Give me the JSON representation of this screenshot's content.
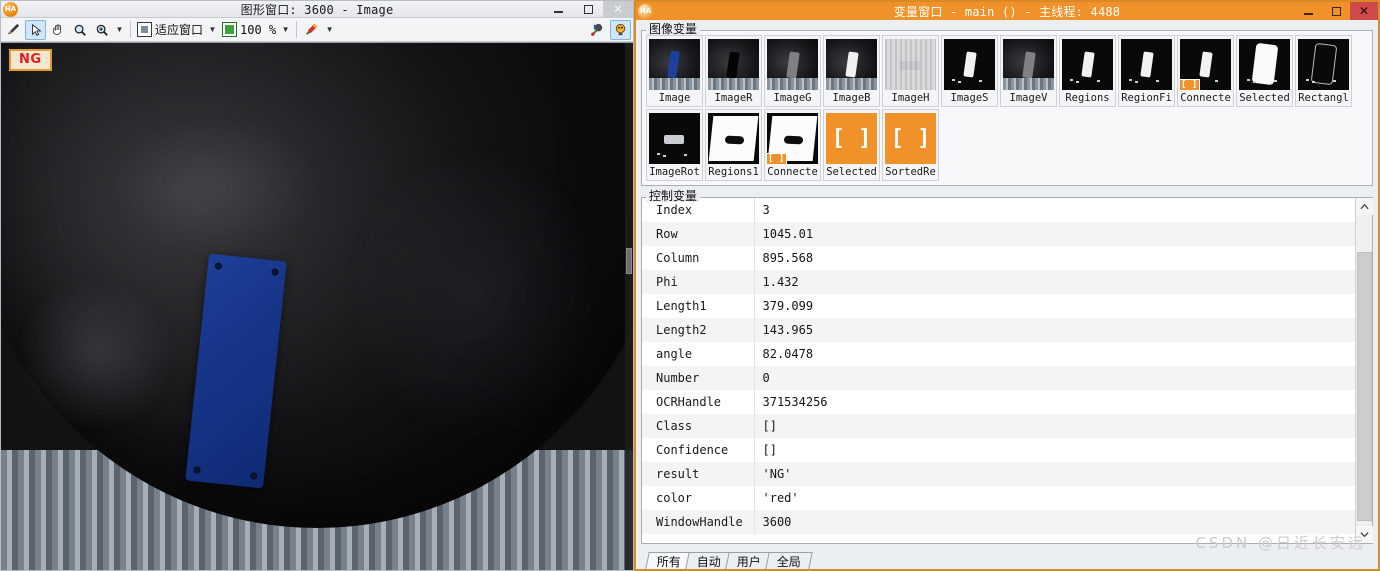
{
  "gfx_window": {
    "app_icon": "halcon-icon",
    "title": "图形窗口: 3600 - Image",
    "window_buttons": {
      "minimize": "–",
      "maximize": "□",
      "close": "✕"
    },
    "toolbar": {
      "tools": [
        {
          "name": "draw-tool-icon",
          "glyph": "✍"
        },
        {
          "name": "arrow-select-icon",
          "glyph": "⬉"
        },
        {
          "name": "pan-hand-icon",
          "glyph": "✋"
        },
        {
          "name": "magnifier-icon",
          "glyph": "🔍"
        },
        {
          "name": "zoom-in-icon",
          "glyph": "🔎"
        }
      ],
      "fit_window_label": "适应窗口",
      "zoom_label": "100 %",
      "color_tool_glyph": "🖌",
      "dropdown_glyph": "▼",
      "right_tools": [
        {
          "name": "measure-tool-icon",
          "glyph": "📐"
        },
        {
          "name": "inspect-tool-icon",
          "glyph": "🔦"
        }
      ]
    },
    "overlay": {
      "ng_badge": "NG"
    }
  },
  "var_window": {
    "app_icon": "halcon-icon",
    "title": "变量窗口 - main () - 主线程: 4488",
    "window_buttons": {
      "minimize": "–",
      "maximize": "□",
      "close": "✕"
    },
    "image_vars": {
      "legend": "图像变量",
      "items": [
        {
          "label": "Image",
          "style": "tv-dark",
          "chip": "blue"
        },
        {
          "label": "ImageR",
          "style": "tv-dark",
          "chip": "black"
        },
        {
          "label": "ImageG",
          "style": "tv-dark",
          "chip": "gray"
        },
        {
          "label": "ImageB",
          "style": "tv-dark",
          "chip": "white"
        },
        {
          "label": "ImageH",
          "style": "tv-bright",
          "chip": "grayband"
        },
        {
          "label": "ImageS",
          "style": "tv-black",
          "chip": "white"
        },
        {
          "label": "ImageV",
          "style": "tv-dark",
          "chip": "gray"
        },
        {
          "label": "Regions",
          "style": "tv-black",
          "chip": "white"
        },
        {
          "label": "RegionFi",
          "style": "tv-black",
          "chip": "white"
        },
        {
          "label": "Connecte",
          "style": "tv-black",
          "chip": "white",
          "badge": "[ ]"
        },
        {
          "label": "Selected",
          "style": "tv-black",
          "chip": "whitebig"
        },
        {
          "label": "Rectangl",
          "style": "tv-black",
          "chip": "outline"
        },
        {
          "label": "ImageRot",
          "style": "tv-black",
          "chip": "grayband"
        },
        {
          "label": "Regions1",
          "style": "tv-white-shape",
          "chip": "none"
        },
        {
          "label": "Connecte",
          "style": "tv-white-shape",
          "chip": "none",
          "badge": "[ ]"
        },
        {
          "label": "Selected",
          "style": "tv-orange",
          "chip": "tuple",
          "tuple_glyph": "[ ]"
        },
        {
          "label": "SortedRe",
          "style": "tv-orange",
          "chip": "tuple",
          "tuple_glyph": "[ ]"
        }
      ]
    },
    "control_vars": {
      "legend": "控制变量",
      "rows": [
        {
          "name": "Index",
          "value": "3"
        },
        {
          "name": "Row",
          "value": "1045.01"
        },
        {
          "name": "Column",
          "value": "895.568"
        },
        {
          "name": "Phi",
          "value": "1.432"
        },
        {
          "name": "Length1",
          "value": "379.099"
        },
        {
          "name": "Length2",
          "value": "143.965"
        },
        {
          "name": "angle",
          "value": "82.0478"
        },
        {
          "name": "Number",
          "value": "0"
        },
        {
          "name": "OCRHandle",
          "value": "371534256"
        },
        {
          "name": "Class",
          "value": "[]"
        },
        {
          "name": "Confidence",
          "value": "[]"
        },
        {
          "name": "result",
          "value": "'NG'"
        },
        {
          "name": "color",
          "value": "'red'"
        },
        {
          "name": "WindowHandle",
          "value": "3600"
        }
      ]
    },
    "scrollbar": {
      "up_glyph": "︿",
      "down_glyph": "﹀"
    },
    "tabs": [
      {
        "label": "所有",
        "selected": true
      },
      {
        "label": "自动",
        "selected": false
      },
      {
        "label": "用户",
        "selected": false
      },
      {
        "label": "全局",
        "selected": false
      }
    ]
  },
  "watermark": "CSDN @日近长安远",
  "colors": {
    "accent_orange": "#f0912a",
    "close_red": "#cf4b4b",
    "ng_red": "#e02020",
    "plate_blue": "#1d3f9e"
  }
}
